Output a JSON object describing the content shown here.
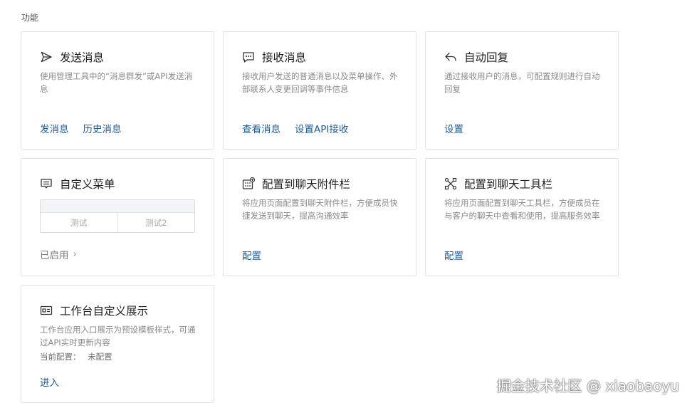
{
  "section_title": "功能",
  "cards": {
    "send": {
      "title": "发送消息",
      "icon": "send-icon",
      "description": "使用管理工具中的“消息群发”或API发送消息",
      "actions": [
        "发消息",
        "历史消息"
      ]
    },
    "receive": {
      "title": "接收消息",
      "icon": "message-icon",
      "description": "接收用户发送的普通消息以及菜单操作、外部联系人变更回调等事件信息",
      "actions": [
        "查看消息",
        "设置API接收"
      ]
    },
    "auto_reply": {
      "title": "自动回复",
      "icon": "reply-icon",
      "description": "通过接收用户的消息，可配置规则进行自动回复",
      "actions": [
        "设置"
      ]
    },
    "custom_menu": {
      "title": "自定义菜单",
      "icon": "menu-icon",
      "menu_items": [
        "测试",
        "测试2"
      ],
      "status": "已启用",
      "status_chevron": "›"
    },
    "attachment_bar": {
      "title": "配置到聊天附件栏",
      "icon": "attachment-grid-icon",
      "description": "将应用页面配置到聊天附件栏，方便成员快捷发送到聊天，提高沟通效率",
      "actions": [
        "配置"
      ]
    },
    "toolbar": {
      "title": "配置到聊天工具栏",
      "icon": "tools-icon",
      "description": "将应用页面配置到聊天工具栏，方便成员在与客户的聊天中查看和使用，提高服务效率",
      "actions": [
        "配置"
      ]
    },
    "workbench": {
      "title": "工作台自定义展示",
      "icon": "id-card-icon",
      "description": "工作台应用入口展示为预设模板样式，可通过API实时更新内容",
      "current_config_label": "当前配置：",
      "current_config_value": "未配置",
      "actions": [
        "进入"
      ]
    }
  },
  "watermark": "掘金技术社区 @ xiaobaoyu",
  "colors": {
    "link": "#1f5c9a",
    "border": "#e2e2e2",
    "muted_text": "#8a8a8a"
  }
}
